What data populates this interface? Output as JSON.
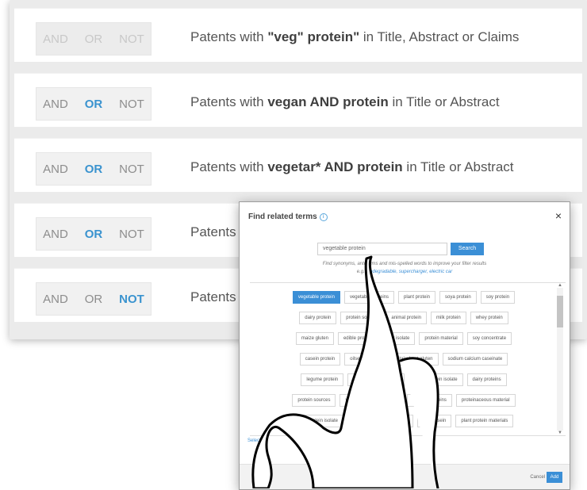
{
  "rows": [
    {
      "and": "AND",
      "or": "OR",
      "not": "NOT",
      "active": "none",
      "parts": [
        {
          "t": "Patents with "
        },
        {
          "t": "\"veg\" protein\"",
          "b": true
        },
        {
          "t": " in Title, Abstract or Claims"
        }
      ]
    },
    {
      "and": "AND",
      "or": "OR",
      "not": "NOT",
      "active": "or",
      "parts": [
        {
          "t": "Patents with "
        },
        {
          "t": "vegan AND protein",
          "b": true
        },
        {
          "t": " in Title or Abstract"
        }
      ]
    },
    {
      "and": "AND",
      "or": "OR",
      "not": "NOT",
      "active": "or",
      "parts": [
        {
          "t": "Patents with "
        },
        {
          "t": "vegetar* AND protein",
          "b": true
        },
        {
          "t": " in Title or Abstract"
        }
      ]
    },
    {
      "and": "AND",
      "or": "OR",
      "not": "NOT",
      "active": "or",
      "parts": [
        {
          "t": "Patents"
        }
      ]
    },
    {
      "and": "AND",
      "or": "OR",
      "not": "NOT",
      "active": "not",
      "parts": [
        {
          "t": "Patents"
        }
      ]
    }
  ],
  "dialog": {
    "title": "Find related terms",
    "close": "×",
    "search_value": "vegetable protein",
    "search_button": "Search",
    "hint_line1": "Find synonyms, antonyms and mis-spelled words to improve your filter results",
    "hint_line2_prefix": "e.g. ",
    "hint_line2_links": "biodegradable, supercharger, electric car",
    "chip_rows": [
      [
        "vegetable protein",
        "vegetable proteins",
        "plant protein",
        "soya protein",
        "soy protein"
      ],
      [
        "dairy protein",
        "protein source",
        "animal protein",
        "milk protein",
        "whey protein"
      ],
      [
        "maize gluten",
        "edible protein",
        "soy isolate",
        "protein material",
        "soy concentrate"
      ],
      [
        "casein protein",
        "oilseed protein",
        "vital wheat gluten",
        "sodium calcium caseinate"
      ],
      [
        "legume protein",
        "peanut protein isolate",
        "wheat protein isolate",
        "dairy proteins"
      ],
      [
        "protein sources",
        "vegetable protein source",
        "legume proteins",
        "proteinaceous material"
      ],
      [
        "soy protein isolate",
        "vegetable protein material",
        "non-casein",
        "plant protein materials"
      ]
    ],
    "select_all": "Select all",
    "cancel": "Cancel",
    "add": "Add"
  }
}
